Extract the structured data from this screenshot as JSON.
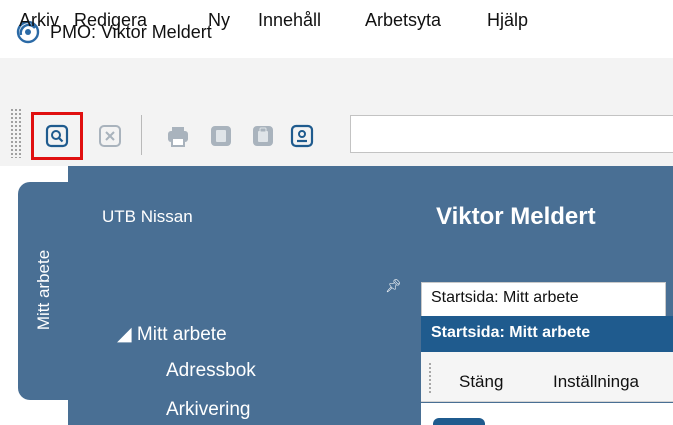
{
  "window": {
    "title": "PMO: Viktor Meldert",
    "logo_icon": "pmo-logo-icon"
  },
  "menu": {
    "items": [
      "Arkiv",
      "Redigera",
      "Ny",
      "Innehåll",
      "Arbetsyta",
      "Hjälp"
    ]
  },
  "toolbar": {
    "buttons": [
      {
        "icon": "search-icon",
        "highlighted": true,
        "enabled": true
      },
      {
        "icon": "close-icon",
        "enabled": false
      },
      {
        "icon": "print-icon",
        "enabled": false
      },
      {
        "icon": "copy-icon",
        "enabled": false
      },
      {
        "icon": "clipboard-icon",
        "enabled": false
      },
      {
        "icon": "contact-card-icon",
        "enabled": true
      }
    ],
    "highlight_color": "#e01010"
  },
  "nav": {
    "vertical_tab_label": "Mitt arbete",
    "org_name": "UTB Nissan",
    "tree": [
      {
        "label": "◢ Mitt arbete",
        "level": 0
      },
      {
        "label": "Adressbok",
        "level": 1
      },
      {
        "label": "Arkivering",
        "level": 1
      }
    ]
  },
  "main": {
    "user_name": "Viktor Meldert",
    "tab_label": "Startsida: Mitt arbete",
    "header_label": "Startsida: Mitt arbete",
    "actions": [
      "Stäng",
      "Inställninga"
    ]
  },
  "colors": {
    "panel_blue": "#496f94",
    "header_blue": "#1f5b8e"
  }
}
